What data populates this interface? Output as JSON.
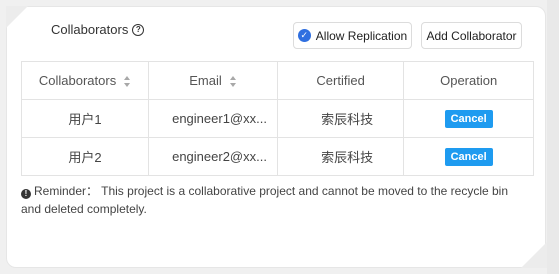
{
  "header": {
    "title": "Collaborators",
    "help_icon": "question-circle-icon",
    "allow_replication_label": "Allow Replication",
    "allow_replication_checked": true,
    "add_collaborator_label": "Add Collaborator"
  },
  "table": {
    "columns": [
      "Collaborators",
      "Email",
      "Certified",
      "Operation"
    ],
    "rows": [
      {
        "name": "用户1",
        "email": "engineer1@xx...",
        "certified": "索辰科技",
        "action": "Cancel"
      },
      {
        "name": "用户2",
        "email": "engineer2@xx...",
        "certified": "索辰科技",
        "action": "Cancel"
      }
    ]
  },
  "reminder": {
    "icon": "info-circle-icon",
    "text": "Reminder：  This project is a collaborative project and cannot be moved to the recycle bin and deleted completely."
  },
  "colors": {
    "accent": "#1e9bf0",
    "checkbox": "#2f6fe0"
  }
}
